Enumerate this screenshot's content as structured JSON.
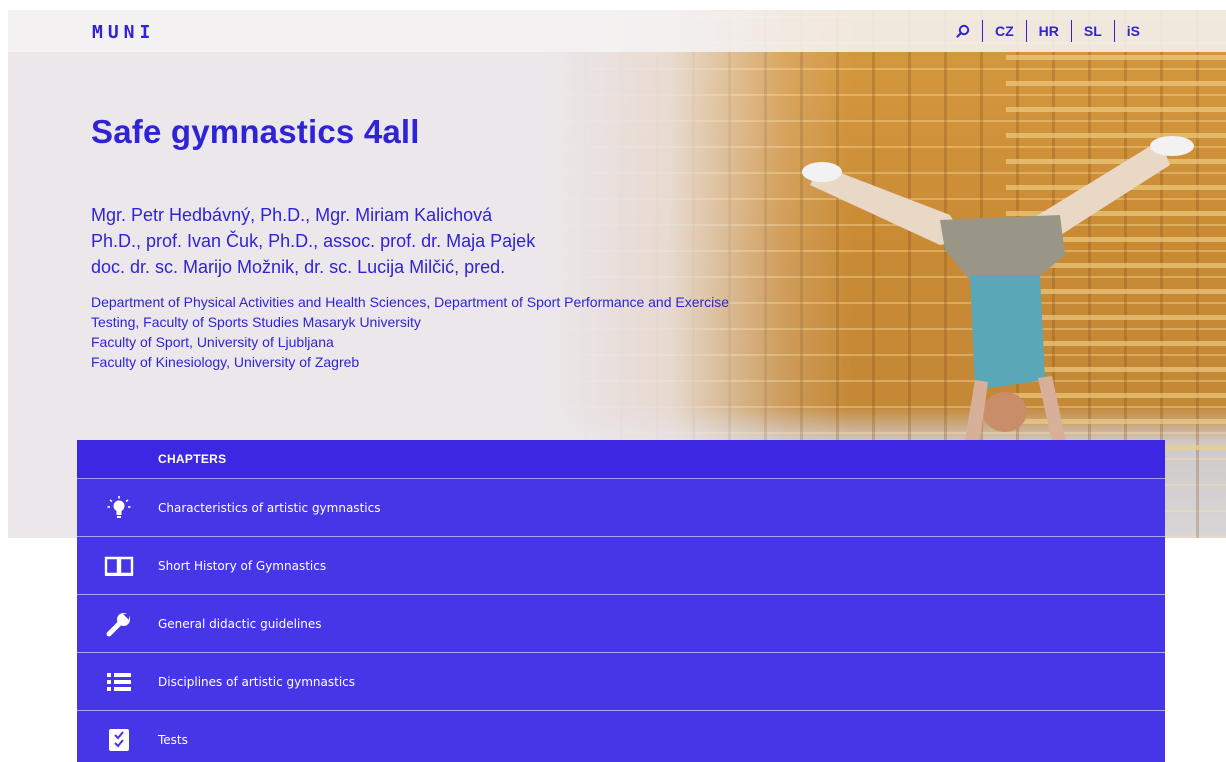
{
  "topbar": {
    "logo": "MUNI",
    "nav": [
      {
        "label": "",
        "icon": "search-icon"
      },
      {
        "label": "CZ"
      },
      {
        "label": "HR"
      },
      {
        "label": "SL"
      },
      {
        "label": "iS"
      }
    ]
  },
  "hero": {
    "title": "Safe gymnastics 4all",
    "authors": [
      "Mgr. Petr Hedbávný, Ph.D., Mgr. Miriam Kalichová",
      "Ph.D., prof. Ivan Čuk, Ph.D., assoc. prof. dr. Maja Pajek",
      "doc. dr. sc. Marijo Možnik, dr. sc. Lucija Milčić, pred."
    ],
    "affiliations": [
      "Department of Physical Activities and Health Sciences, Department of Sport Performance and Exercise",
      "Testing, Faculty of Sports Studies Masaryk University",
      "Faculty of Sport, University of Ljubljana",
      "Faculty of Kinesiology, University of Zagreb"
    ]
  },
  "chapters": {
    "heading": "CHAPTERS",
    "items": [
      {
        "label": "Characteristics of artistic gymnastics",
        "icon": "lightbulb-icon"
      },
      {
        "label": "Short History of Gymnastics",
        "icon": "open-book-icon"
      },
      {
        "label": "General didactic guidelines",
        "icon": "wrench-icon"
      },
      {
        "label": "Disciplines of artistic gymnastics",
        "icon": "list-icon"
      },
      {
        "label": "Tests",
        "icon": "checklist-icon"
      }
    ]
  },
  "colors": {
    "brand": "#2e24d6",
    "panel": "#4232e6",
    "hero_bg": "#ece7ea"
  }
}
